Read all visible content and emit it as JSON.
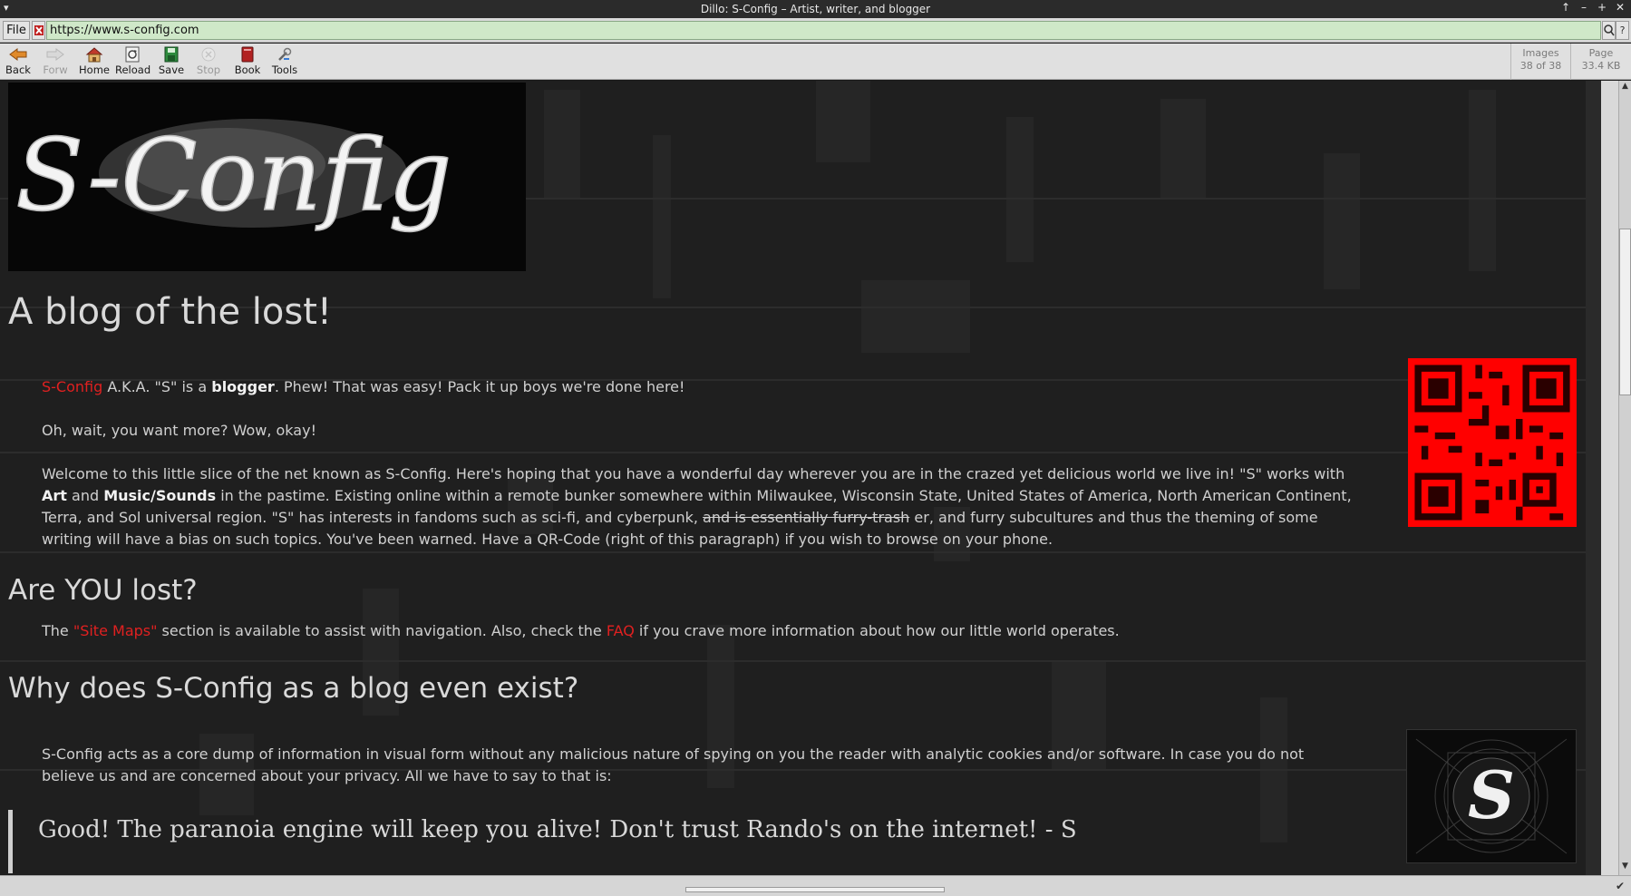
{
  "window": {
    "title": "Dillo: S-Config – Artist, writer, and blogger",
    "controls": [
      "↑",
      "–",
      "+",
      "✕"
    ]
  },
  "urlbar": {
    "file_label": "File",
    "url": "https://www.s-config.com",
    "help_label": "?"
  },
  "toolbar": {
    "buttons": [
      {
        "label": "Back",
        "icon": "back-arrow-icon",
        "enabled": true
      },
      {
        "label": "Forw",
        "icon": "forward-arrow-icon",
        "enabled": false
      },
      {
        "label": "Home",
        "icon": "home-icon",
        "enabled": true
      },
      {
        "label": "Reload",
        "icon": "reload-icon",
        "enabled": true
      },
      {
        "label": "Save",
        "icon": "save-icon",
        "enabled": true
      },
      {
        "label": "Stop",
        "icon": "stop-icon",
        "enabled": false
      },
      {
        "label": "Book",
        "icon": "bookmark-icon",
        "enabled": true
      },
      {
        "label": "Tools",
        "icon": "tools-icon",
        "enabled": true
      }
    ],
    "images_label": "Images",
    "images_value": "38 of 38",
    "page_label": "Page",
    "page_value": "33.4 KB"
  },
  "content": {
    "logo_text": "S-Config",
    "page_title": "A blog of the lost!",
    "intro": {
      "link": "S-Config",
      "text1": " A.K.A. \"S\" is a ",
      "bold1": "blogger",
      "text2": ". Phew! That was easy! Pack it up boys we're done here!"
    },
    "para2": "Oh, wait, you want more? Wow, okay!",
    "para3": {
      "t1": "Welcome to this little slice of the net known as S-Config. Here's hoping that you have a wonderful day wherever you are in the crazed yet delicious world we live in! \"S\" works with ",
      "b1": "Art",
      "t2": " and ",
      "b2": "Music/Sounds",
      "t3": " in the pastime. Existing online within a remote bunker somewhere within Milwaukee, Wisconsin State, United States of America, North American Continent, Terra, and Sol universal region. \"S\" has interests in fandoms such as sci-fi, and cyberpunk, ",
      "strike": "and is essentially furry-trash",
      "t4": " er, and furry subcultures and thus the theming of some writing will have a bias on such topics. You've been warned. Have a QR-Code (right of this paragraph) if you wish to browse on your phone."
    },
    "h2_lost": "Are YOU lost?",
    "para4": {
      "t1": "The ",
      "link1": "\"Site Maps\"",
      "t2": " section is available to assist with navigation. Also, check the ",
      "link2": "FAQ",
      "t3": " if you crave more information about how our little world operates."
    },
    "h2_why": "Why does S-Config as a blog even exist?",
    "para5": "S-Config acts as a core dump of information in visual form without any malicious nature of spying on you the reader with analytic cookies and/or software. In case you do not believe us and are concerned about your privacy. All we have to say to that is:",
    "quote": "Good! The paranoia engine will keep you alive! Don't trust Rando's on the internet! - S",
    "emblem_letter": "S"
  },
  "colors": {
    "link": "#e02020",
    "qr": "#ff0000",
    "url_bg": "#cfe8c8"
  }
}
